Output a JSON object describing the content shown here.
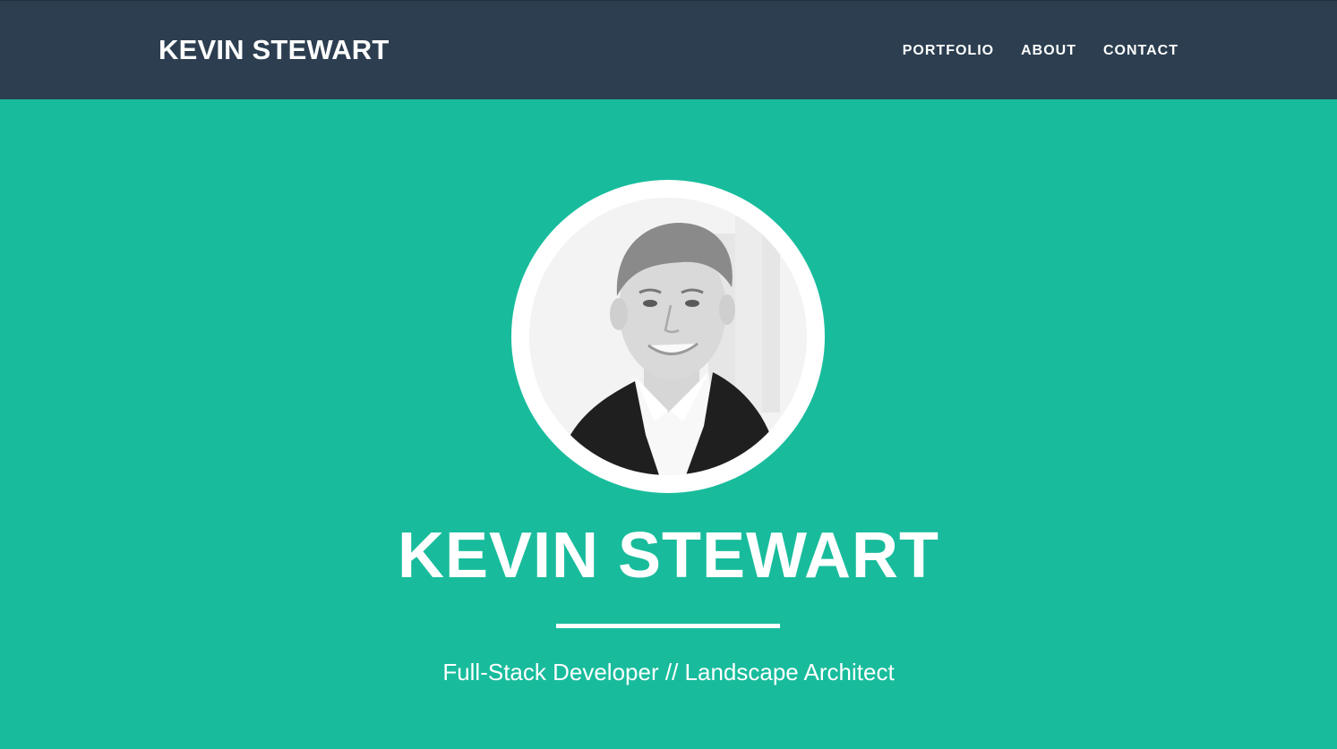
{
  "navbar": {
    "brand": "KEVIN STEWART",
    "links": [
      {
        "label": "PORTFOLIO"
      },
      {
        "label": "ABOUT"
      },
      {
        "label": "CONTACT"
      }
    ]
  },
  "hero": {
    "avatar_icon": "profile-photo",
    "title": "KEVIN STEWART",
    "subtitle": "Full-Stack Developer // Landscape Architect"
  },
  "colors": {
    "navbar_bg": "#2c3e50",
    "hero_bg": "#18bc9c",
    "text": "#ffffff"
  }
}
